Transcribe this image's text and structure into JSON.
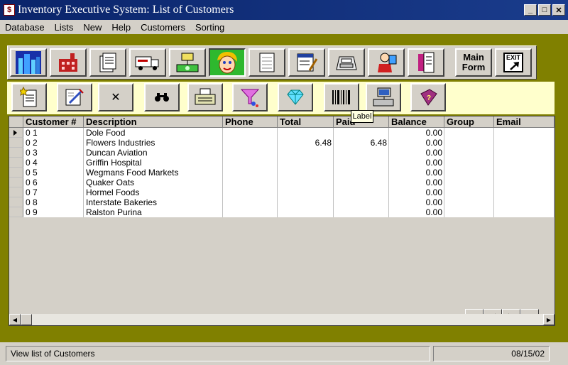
{
  "window": {
    "title": "Inventory Executive System: List of Customers",
    "icon_glyph": "$",
    "minimize": "_",
    "maximize": "□",
    "close": "✕"
  },
  "menu": [
    "Database",
    "Lists",
    "New",
    "Help",
    "Customers",
    "Sorting"
  ],
  "toolbar": {
    "buttons": [
      {
        "icon": "city-icon"
      },
      {
        "icon": "factory-icon"
      },
      {
        "icon": "documents-icon"
      },
      {
        "icon": "delivery-truck-icon"
      },
      {
        "icon": "money-transfer-icon"
      },
      {
        "icon": "customer-face-icon",
        "active": true
      },
      {
        "icon": "blank-form-icon"
      },
      {
        "icon": "invoice-icon"
      },
      {
        "icon": "cash-register-icon"
      },
      {
        "icon": "salesperson-icon"
      },
      {
        "icon": "receipt-icon"
      }
    ],
    "main_form_label": "Main\nForm",
    "exit_label": "EXIT"
  },
  "subtoolbar": {
    "buttons": [
      {
        "icon": "new-document-icon"
      },
      {
        "icon": "edit-document-icon"
      },
      {
        "icon": "delete-icon",
        "glyph": "✕"
      },
      {
        "icon": "binoculars-icon",
        "glyph": "👓"
      },
      {
        "icon": "typewriter-icon"
      },
      {
        "icon": "funnel-filter-icon"
      },
      {
        "icon": "diamond-icon"
      },
      {
        "icon": "barcode-label-icon"
      },
      {
        "icon": "computer-network-icon"
      },
      {
        "icon": "help-book-icon"
      }
    ],
    "tooltip": "Label"
  },
  "grid": {
    "columns": [
      "Customer #",
      "Description",
      "Phone",
      "Total",
      "Paid",
      "Balance",
      "Group",
      "Email"
    ],
    "rows": [
      {
        "customer": "0 1",
        "description": "Dole Food",
        "phone": "",
        "total": "",
        "paid": "",
        "balance": "0.00",
        "group": "",
        "email": ""
      },
      {
        "customer": "0 2",
        "description": "Flowers Industries",
        "phone": "",
        "total": "6.48",
        "paid": "6.48",
        "balance": "0.00",
        "group": "",
        "email": ""
      },
      {
        "customer": "0 3",
        "description": "Duncan Aviation",
        "phone": "",
        "total": "",
        "paid": "",
        "balance": "0.00",
        "group": "",
        "email": ""
      },
      {
        "customer": "0 4",
        "description": "Griffin Hospital",
        "phone": "",
        "total": "",
        "paid": "",
        "balance": "0.00",
        "group": "",
        "email": ""
      },
      {
        "customer": "0 5",
        "description": "Wegmans Food Markets",
        "phone": "",
        "total": "",
        "paid": "",
        "balance": "0.00",
        "group": "",
        "email": ""
      },
      {
        "customer": "0 6",
        "description": "Quaker Oats",
        "phone": "",
        "total": "",
        "paid": "",
        "balance": "0.00",
        "group": "",
        "email": ""
      },
      {
        "customer": "0 7",
        "description": "Hormel Foods",
        "phone": "",
        "total": "",
        "paid": "",
        "balance": "0.00",
        "group": "",
        "email": ""
      },
      {
        "customer": "0 8",
        "description": "Interstate Bakeries",
        "phone": "",
        "total": "",
        "paid": "",
        "balance": "0.00",
        "group": "",
        "email": ""
      },
      {
        "customer": "0 9",
        "description": "Ralston Purina",
        "phone": "",
        "total": "",
        "paid": "",
        "balance": "0.00",
        "group": "",
        "email": ""
      }
    ],
    "nav": [
      "⏮",
      "◀",
      "▶",
      "⏭"
    ]
  },
  "status": {
    "message": "View list of Customers",
    "date": "08/15/02"
  },
  "colors": {
    "frame": "#808000",
    "subtoolbar_bg": "#ffffcc",
    "active_button": "#2eb82e",
    "title_bar": "#0a246a"
  }
}
